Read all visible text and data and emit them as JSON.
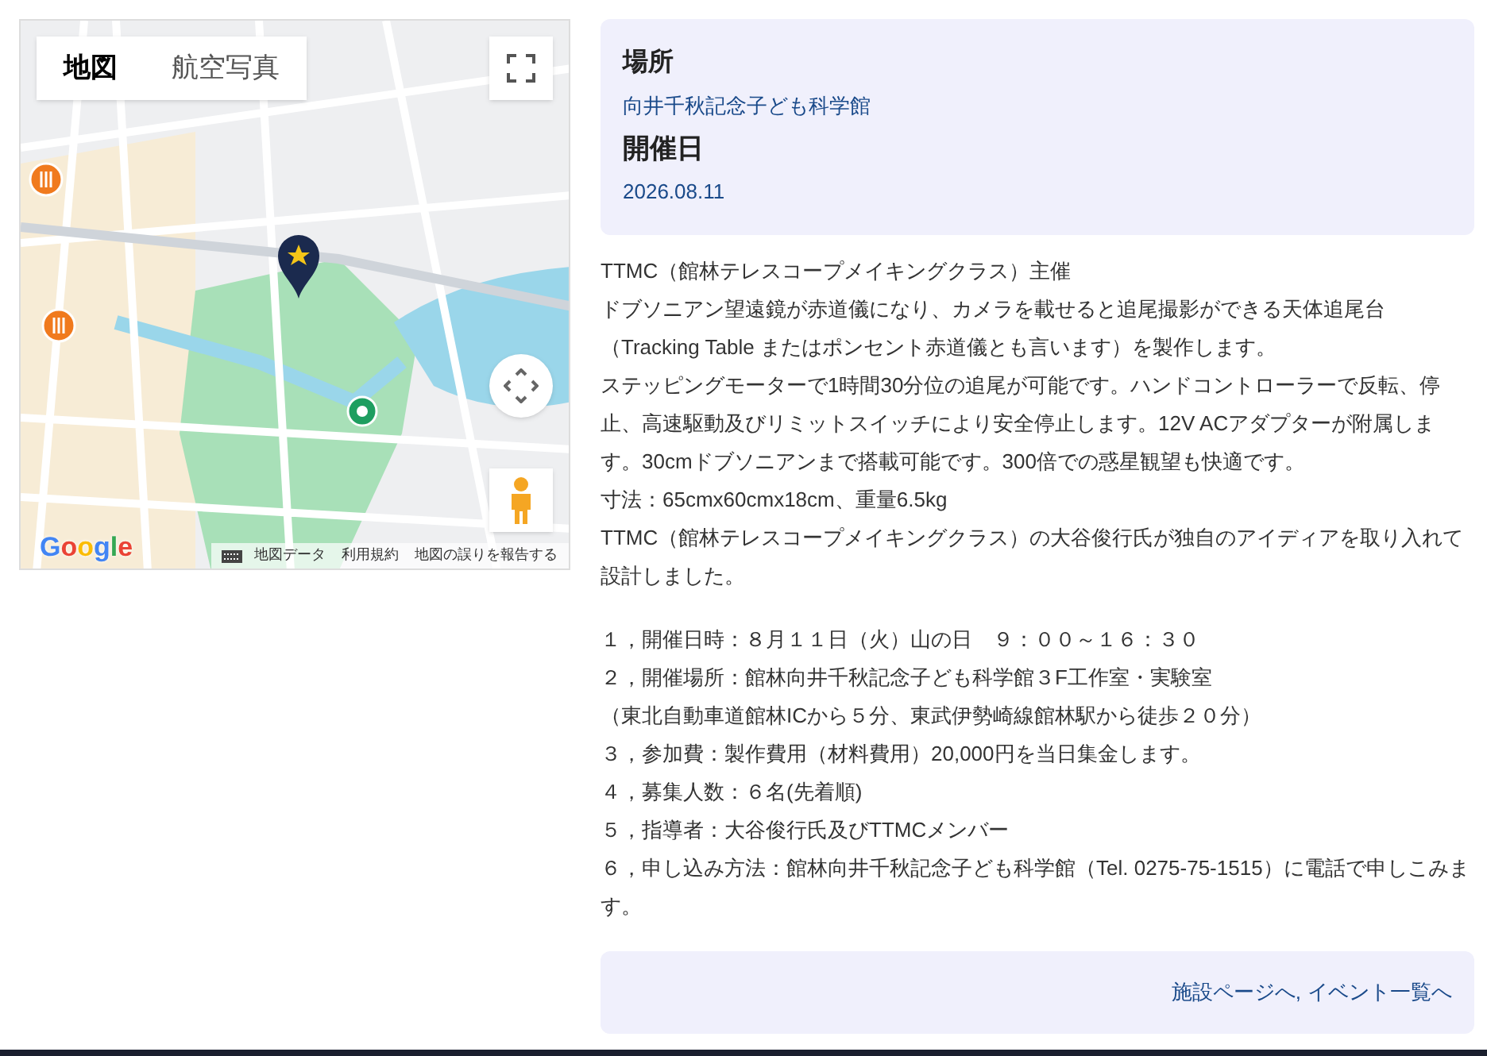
{
  "map": {
    "map_types": [
      {
        "label": "地図",
        "selected": true
      },
      {
        "label": "航空写真",
        "selected": false
      }
    ],
    "logo": "Google",
    "attribution": [
      "地図データ",
      "利用規約",
      "地図の誤りを報告する"
    ]
  },
  "info": [
    {
      "heading": "場所",
      "value": "向井千秋記念子ども科学館"
    },
    {
      "heading": "開催日",
      "value": "2026.08.11"
    }
  ],
  "description": [
    "TTMC（館林テレスコープメイキングクラス）主催",
    "ドブソニアン望遠鏡が赤道儀になり、カメラを載せると追尾撮影ができる天体追尾台（Tracking Table またはポンセント赤道儀とも言います）を製作します。",
    "ステッピングモーターで1時間30分位の追尾が可能です。ハンドコントローラーで反転、停止、高速駆動及びリミットスイッチにより安全停止します。12V ACアダプターが附属します。30cmドブソニアンまで搭載可能です。300倍での惑星観望も快適です。",
    "寸法：65cmx60cmx18cm、重量6.5kg",
    "TTMC（館林テレスコープメイキングクラス）の大谷俊行氏が独自のアイディアを取り入れて設計しました。"
  ],
  "details": [
    "１，開催日時：８月１１日（火）山の日　９：００～１６：３０",
    "２，開催場所：館林向井千秋記念子ども科学館３F工作室・実験室",
    "（東北自動車道館林ICから５分、東武伊勢崎線館林駅から徒歩２０分）",
    "３，参加費：製作費用（材料費用）20,000円を当日集金します。",
    "４，募集人数：６名(先着順)",
    "５，指導者：大谷俊行氏及びTTMCメンバー",
    "６，申し込み方法：館林向井千秋記念子ども科学館（Tel. 0275-75-1515）に電話で申しこみます。"
  ],
  "links": [
    {
      "label": "施設ページへ"
    },
    {
      "label": "イベント一覧へ"
    }
  ],
  "link_separator": ","
}
